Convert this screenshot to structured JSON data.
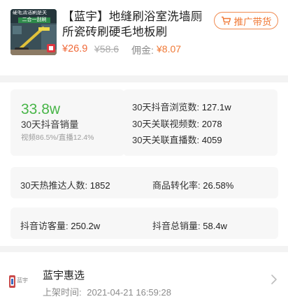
{
  "product": {
    "title": "【蓝宇】地缝刷浴室洗墙厕所瓷砖刷硬毛地板刷",
    "promo_label": "推广带货",
    "price": "¥26.9",
    "original_price": "¥58.6",
    "commission_label": "佣金:",
    "commission_value": "¥8.07",
    "thumb_text_top": "硬毛清洁刷是关",
    "thumb_text_mid": "二合一刮刷"
  },
  "sales": {
    "value": "33.8w",
    "label": "30天抖音销量",
    "split": "视频86.5%/直播12.4%"
  },
  "stats_right": [
    {
      "label": "30天抖音浏览数:",
      "value": "127.1w"
    },
    {
      "label": "30天关联视频数:",
      "value": "2078"
    },
    {
      "label": "30天关联直播数:",
      "value": "4059"
    }
  ],
  "stats_row2": [
    {
      "label": "30天热推达人数:",
      "value": "1852"
    },
    {
      "label": "商品转化率:",
      "value": "26.58%"
    }
  ],
  "stats_row3": [
    {
      "label": "抖音访客量:",
      "value": "250.2w"
    },
    {
      "label": "抖音总销量:",
      "value": "58.4w"
    }
  ],
  "shop": {
    "logo_text": "蓝宇",
    "name": "蓝宇惠选",
    "listed_label": "上架时间:",
    "listed_time": "2021-04-21 16:59:28"
  },
  "colors": {
    "accent_orange": "#f07834",
    "green": "#48b548",
    "card_bg": "#f7f7f7"
  },
  "icons": {
    "promo": "cart-icon",
    "badge": "store-badge-icon",
    "chevron": "chevron-right-icon"
  }
}
